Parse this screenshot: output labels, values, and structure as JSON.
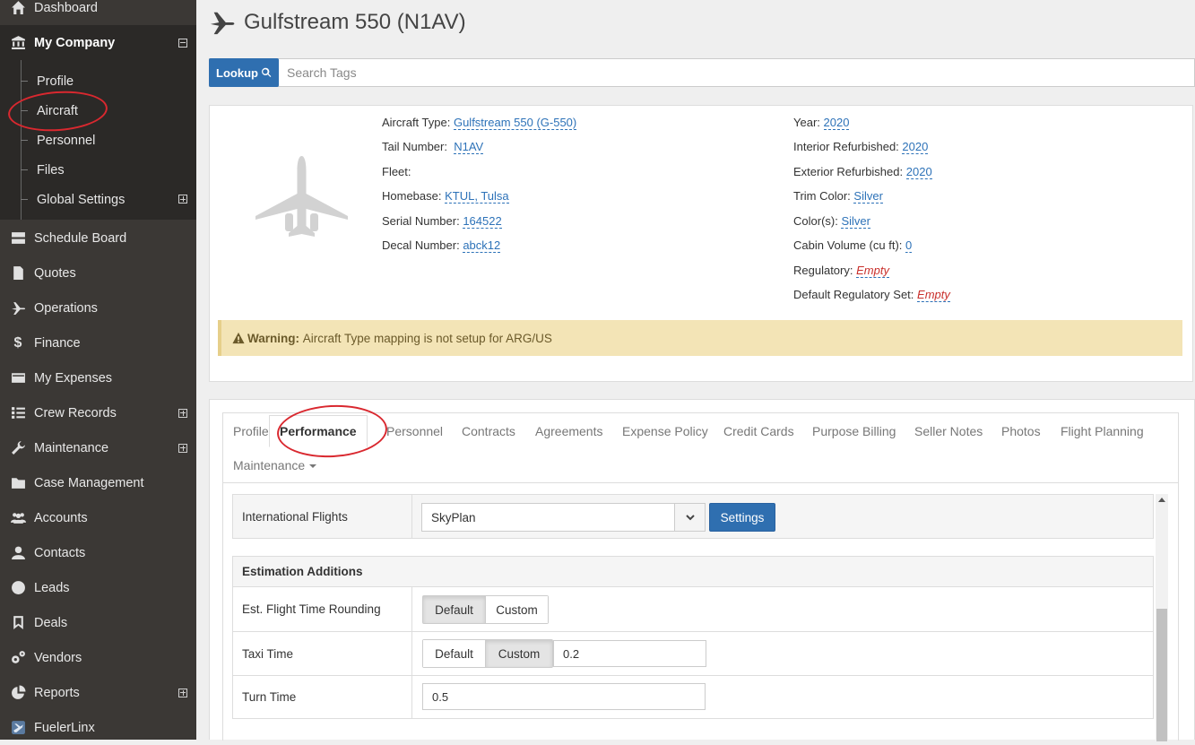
{
  "sidebar": {
    "items": [
      {
        "label": "Dashboard",
        "icon": "home-icon"
      },
      {
        "label": "My Company",
        "icon": "bank-icon"
      },
      {
        "label": "Schedule Board",
        "icon": "server-icon"
      },
      {
        "label": "Quotes",
        "icon": "document-dollar-icon"
      },
      {
        "label": "Operations",
        "icon": "plane-icon"
      },
      {
        "label": "Finance",
        "icon": "dollar-icon"
      },
      {
        "label": "My Expenses",
        "icon": "credit-card-icon"
      },
      {
        "label": "Crew Records",
        "icon": "list-icon"
      },
      {
        "label": "Maintenance",
        "icon": "wrench-icon"
      },
      {
        "label": "Case Management",
        "icon": "folder-icon"
      },
      {
        "label": "Accounts",
        "icon": "users-icon"
      },
      {
        "label": "Contacts",
        "icon": "user-icon"
      },
      {
        "label": "Leads",
        "icon": "dashboard-icon"
      },
      {
        "label": "Deals",
        "icon": "bookmark-icon"
      },
      {
        "label": "Vendors",
        "icon": "gears-icon"
      },
      {
        "label": "Reports",
        "icon": "pie-chart-icon"
      },
      {
        "label": "FuelerLinx",
        "icon": "fuelerlinx-icon"
      }
    ],
    "submenu": [
      "Profile",
      "Aircraft",
      "Personnel",
      "Files",
      "Global Settings"
    ]
  },
  "page": {
    "title": "Gulfstream 550 (N1AV)"
  },
  "search": {
    "lookup_label": "Lookup",
    "placeholder": "Search Tags"
  },
  "aircraft": {
    "left": [
      {
        "label": "Aircraft Type:",
        "value": "Gulfstream 550 (G-550)"
      },
      {
        "label": "Tail Number:",
        "value": "N1AV"
      },
      {
        "label": "Fleet:",
        "value": ""
      },
      {
        "label": "Homebase:",
        "value": "KTUL, Tulsa"
      },
      {
        "label": "Serial Number:",
        "value": "164522"
      },
      {
        "label": "Decal Number:",
        "value": "abck12"
      }
    ],
    "right": [
      {
        "label": "Year:",
        "value": "2020"
      },
      {
        "label": "Interior Refurbished:",
        "value": "2020"
      },
      {
        "label": "Exterior Refurbished:",
        "value": "2020"
      },
      {
        "label": "Trim Color:",
        "value": "Silver"
      },
      {
        "label": "Color(s):",
        "value": "Silver"
      },
      {
        "label": "Cabin Volume (cu ft):",
        "value": "0"
      },
      {
        "label": "Regulatory:",
        "value": "Empty"
      },
      {
        "label": "Default Regulatory Set:",
        "value": "Empty"
      }
    ]
  },
  "warning": {
    "title": "Warning:",
    "text": "Aircraft Type mapping is not setup for ARG/US"
  },
  "tabs": [
    "Profile",
    "Performance",
    "Personnel",
    "Contracts",
    "Agreements",
    "Expense Policy",
    "Credit Cards",
    "Purpose Billing",
    "Seller Notes",
    "Photos",
    "Flight Planning",
    "Maintenance"
  ],
  "form": {
    "international_flights": {
      "label": "International Flights",
      "value": "SkyPlan",
      "button": "Settings"
    },
    "section": "Estimation Additions",
    "rounding": {
      "label": "Est. Flight Time Rounding",
      "options": [
        "Default",
        "Custom"
      ],
      "selected": "Default"
    },
    "taxi": {
      "label": "Taxi Time",
      "options": [
        "Default",
        "Custom"
      ],
      "selected": "Custom",
      "value": "0.2"
    },
    "turn": {
      "label": "Turn Time",
      "value": "0.5"
    }
  },
  "colors": {
    "sidebar": "#3b3835",
    "accent": "#2f6fb0",
    "link": "#2d72b8",
    "warning_bg": "#f3e4b6",
    "annotation": "#d9282f"
  }
}
